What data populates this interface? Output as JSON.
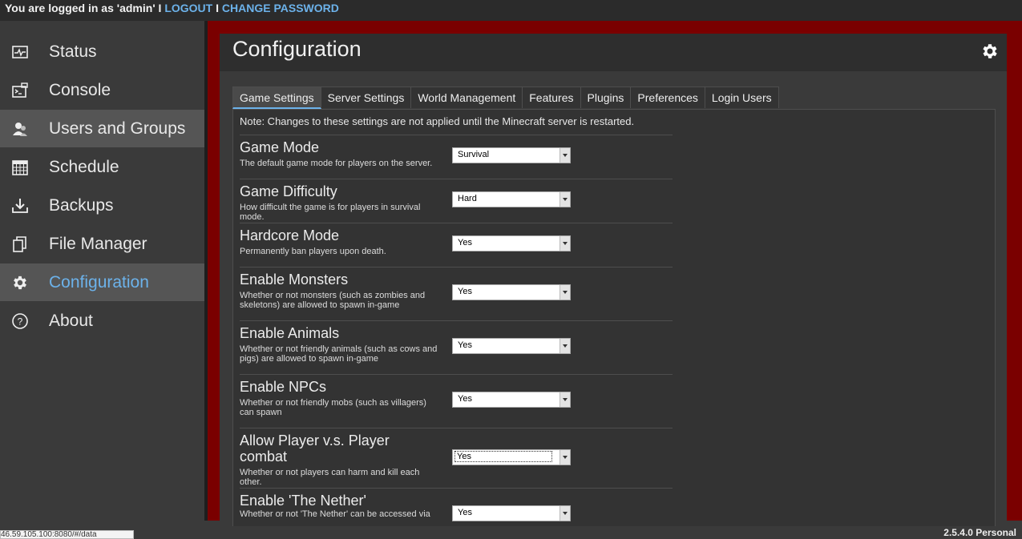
{
  "topbar": {
    "user_text": "You are logged in as 'admin' I",
    "logout": "LOGOUT",
    "sep": "I",
    "change_password": "CHANGE PASSWORD"
  },
  "sidebar": {
    "items": [
      {
        "label": "Status",
        "icon": "status-icon"
      },
      {
        "label": "Console",
        "icon": "console-icon"
      },
      {
        "label": "Users and Groups",
        "icon": "users-icon"
      },
      {
        "label": "Schedule",
        "icon": "schedule-icon"
      },
      {
        "label": "Backups",
        "icon": "backups-icon"
      },
      {
        "label": "File Manager",
        "icon": "file-manager-icon"
      },
      {
        "label": "Configuration",
        "icon": "gear-icon"
      },
      {
        "label": "About",
        "icon": "about-icon"
      }
    ]
  },
  "panel": {
    "title": "Configuration",
    "tabs": [
      "Game Settings",
      "Server Settings",
      "World Management",
      "Features",
      "Plugins",
      "Preferences",
      "Login Users"
    ],
    "note": "Note: Changes to these settings are not applied until the Minecraft server is restarted.",
    "settings": [
      {
        "title": "Game Mode",
        "desc": "The default game mode for players on the server.",
        "value": "Survival"
      },
      {
        "title": "Game Difficulty",
        "desc": "How difficult the game is for players in survival mode.",
        "value": "Hard"
      },
      {
        "title": "Hardcore Mode",
        "desc": "Permanently ban players upon death.",
        "value": "Yes"
      },
      {
        "title": "Enable Monsters",
        "desc": "Whether or not monsters (such as zombies and skeletons) are allowed to spawn in-game",
        "value": "Yes"
      },
      {
        "title": "Enable Animals",
        "desc": "Whether or not friendly animals (such as cows and pigs) are allowed to spawn in-game",
        "value": "Yes"
      },
      {
        "title": "Enable NPCs",
        "desc": "Whether or not friendly mobs (such as villagers) can spawn",
        "value": "Yes"
      },
      {
        "title": "Allow Player v.s. Player combat",
        "desc": "Whether or not players can harm and kill each other.",
        "value": "Yes"
      },
      {
        "title": "Enable 'The Nether'",
        "desc": "Whether or not 'The Nether' can be accessed via",
        "value": "Yes"
      }
    ]
  },
  "footer": {
    "status_url": "46.59.105.100:8080/#/data",
    "version": "2.5.4.0 Personal"
  }
}
